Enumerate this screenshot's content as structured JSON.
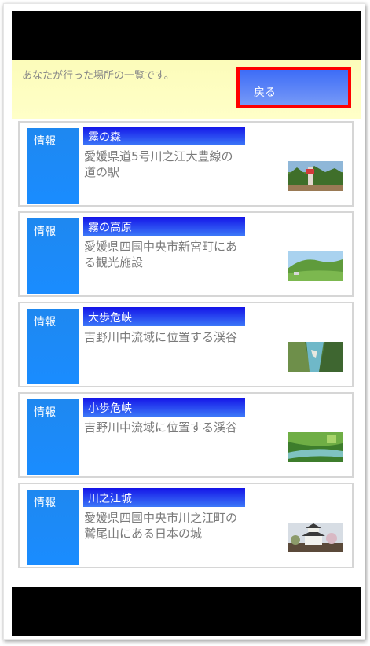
{
  "header": {
    "message": "あなたが行った場所の一覧です。",
    "back_label": "戻る"
  },
  "places": [
    {
      "info_label": "情報",
      "title": "霧の森",
      "description": "愛媛県道5号川之江大豊線の道の駅",
      "thumbnail": "forest-photo"
    },
    {
      "info_label": "情報",
      "title": "霧の高原",
      "description": "愛媛県四国中央市新宮町にある観光施設",
      "thumbnail": "highland-photo"
    },
    {
      "info_label": "情報",
      "title": "大歩危峡",
      "description": "吉野川中流域に位置する渓谷",
      "thumbnail": "gorge-photo"
    },
    {
      "info_label": "情報",
      "title": "小歩危峡",
      "description": "吉野川中流域に位置する渓谷",
      "thumbnail": "gorge-green-photo"
    },
    {
      "info_label": "情報",
      "title": "川之江城",
      "description": "愛媛県四国中央市川之江町の鷲尾山にある日本の城",
      "thumbnail": "castle-photo"
    }
  ],
  "colors": {
    "header_bg": "#ffffc8",
    "back_button": "#4a7af7",
    "back_border": "#ff0000",
    "info_button": "#1a8cff",
    "title_bar": "#1414e8"
  }
}
